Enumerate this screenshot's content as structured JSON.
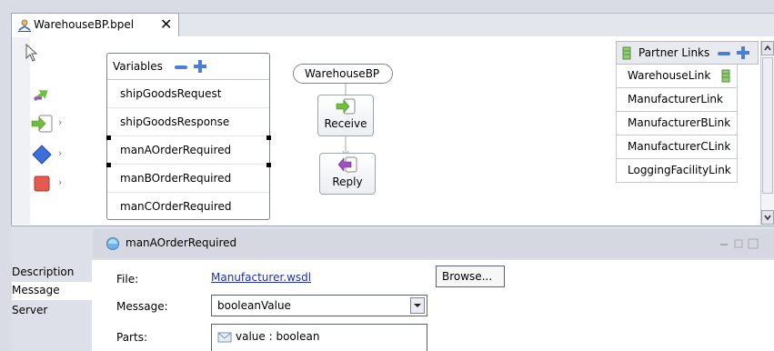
{
  "editor": {
    "tab_title": "WarehouseBP.bpel",
    "tab_close": "✕"
  },
  "variables": {
    "header": "Variables",
    "items": [
      "shipGoodsRequest",
      "shipGoodsResponse",
      "manAOrderRequired",
      "manBOrderRequired",
      "manCOrderRequired"
    ]
  },
  "process": {
    "name": "WarehouseBP",
    "activities": [
      "Receive",
      "Reply"
    ]
  },
  "partner_links": {
    "header": "Partner Links",
    "items": [
      "WarehouseLink",
      "ManufacturerLink",
      "ManufacturerBLink",
      "ManufacturerCLink",
      "LoggingFacilityLink"
    ]
  },
  "properties": {
    "title": "manAOrderRequired",
    "tabs": [
      "Description",
      "Message",
      "Server"
    ],
    "file_label": "File:",
    "file_value": "Manufacturer.wsdl",
    "browse_label": "Browse...",
    "message_label": "Message:",
    "message_value": "booleanValue",
    "parts_label": "Parts:",
    "parts_value": "value : boolean"
  },
  "colors": {
    "accent_blue": "#4a7fd6",
    "link_blue": "#1f2fb5",
    "frame": "#d9dce4"
  }
}
